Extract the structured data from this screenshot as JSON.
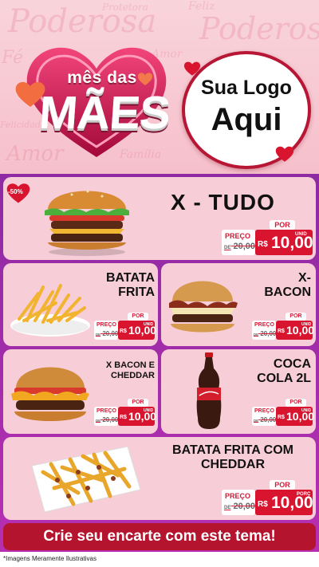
{
  "header": {
    "bg_words": [
      "Poderosa",
      "Poderosa",
      "Protetora",
      "Feliz",
      "Fé",
      "Amor",
      "Felicidade",
      "Amor",
      "Família"
    ],
    "brand_line1": "mês das",
    "brand_line2": "MÃES",
    "logo_line1": "Sua Logo",
    "logo_line2": "Aqui"
  },
  "colors": {
    "brand_red": "#d8142f",
    "card_bg": "#f7cdd8",
    "panel": "#9c2aa8"
  },
  "discount_badge": "-50%",
  "products": [
    {
      "name_lines": [
        "X - TUDO"
      ],
      "por": "POR",
      "preco": "PREÇO",
      "de": "DE",
      "old": "20,00",
      "rs": "R$",
      "new": "10,00",
      "unit": "UNID",
      "image": "burger-x-tudo"
    },
    {
      "name_lines": [
        "BATATA",
        "FRITA"
      ],
      "por": "POR",
      "preco": "PREÇO",
      "de": "DE",
      "old": "20,00",
      "rs": "R$",
      "new": "10,00",
      "unit": "UNID",
      "image": "fries"
    },
    {
      "name_lines": [
        "X-",
        "BACON"
      ],
      "por": "POR",
      "preco": "PREÇO",
      "de": "DE",
      "old": "20,00",
      "rs": "R$",
      "new": "10,00",
      "unit": "UNID",
      "image": "burger-x-bacon"
    },
    {
      "name_lines": [
        "X BACON E",
        "CHEDDAR"
      ],
      "por": "POR",
      "preco": "PREÇO",
      "de": "DE",
      "old": "20,00",
      "rs": "R$",
      "new": "10,00",
      "unit": "UNID",
      "image": "burger-bacon-cheddar"
    },
    {
      "name_lines": [
        "COCA",
        "COLA 2L"
      ],
      "por": "POR",
      "preco": "PREÇO",
      "de": "DE",
      "old": "20,00",
      "rs": "R$",
      "new": "10,00",
      "unit": "UNID",
      "image": "coca-cola-bottle"
    },
    {
      "name_lines": [
        "BATATA FRITA COM",
        "CHEDDAR"
      ],
      "por": "POR",
      "preco": "PREÇO",
      "de": "DE",
      "old": "20,00",
      "rs": "R$",
      "new": "10,00",
      "unit": "PORÇ",
      "image": "fries-cheddar"
    }
  ],
  "cta": "Crie seu encarte com este tema!",
  "footnote": "*Imagens Meramente Ilustrativas"
}
